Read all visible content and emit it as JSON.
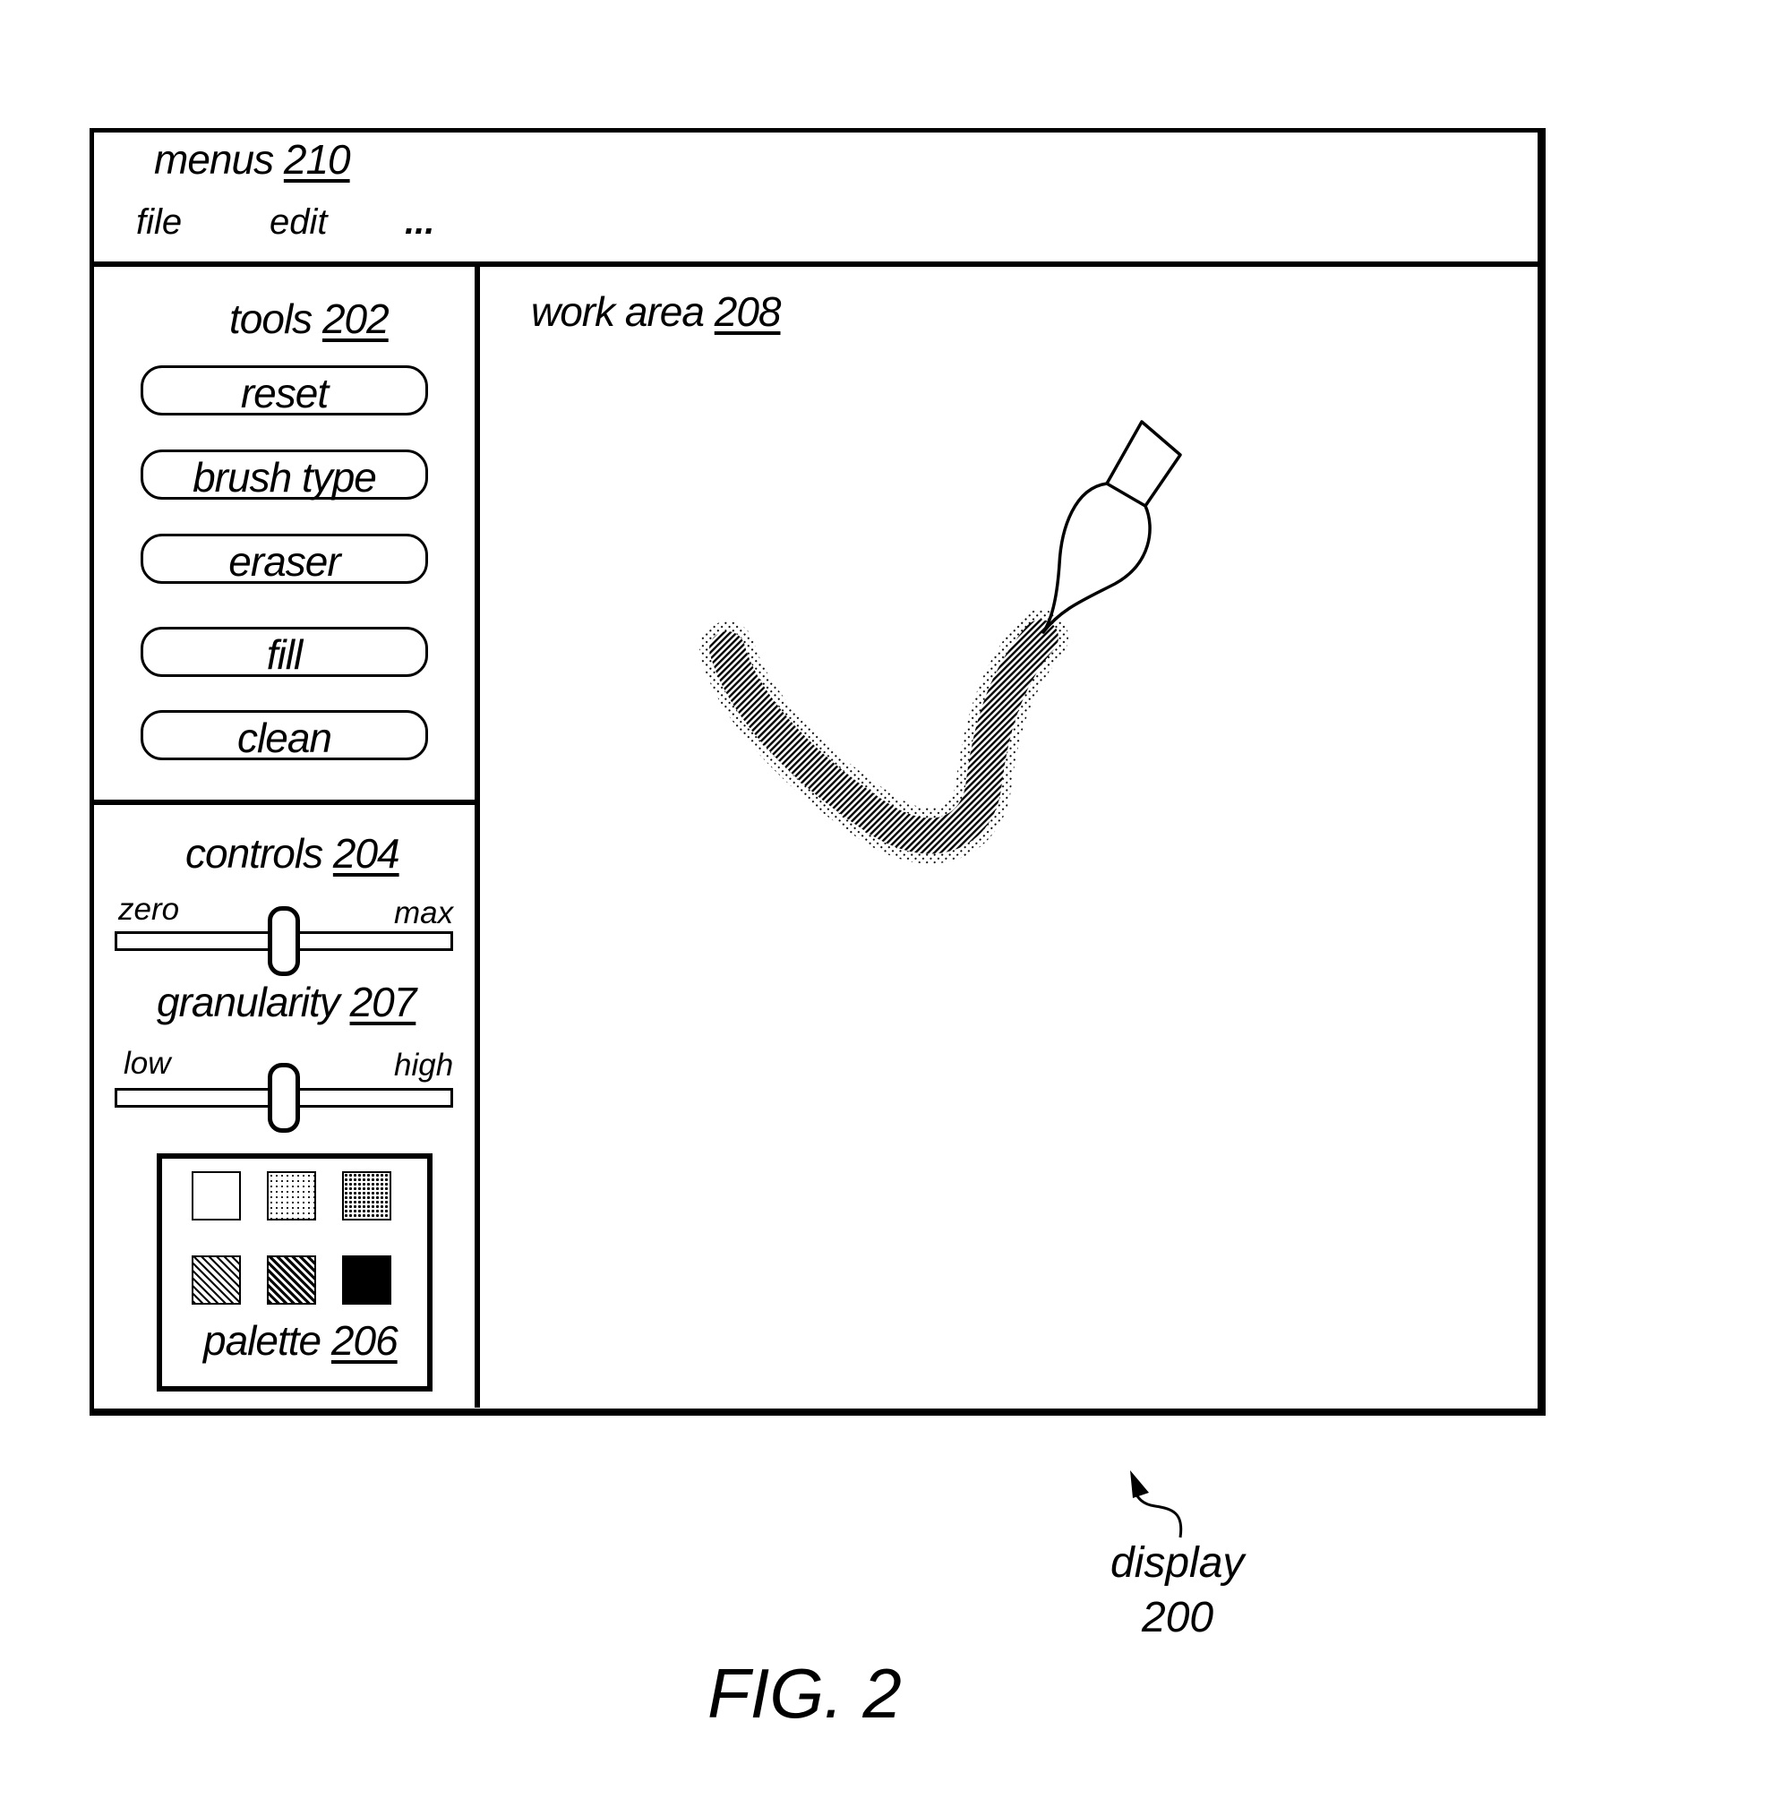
{
  "figure": {
    "caption": "FIG. 2",
    "display_label": "display",
    "display_ref": "200"
  },
  "menus": {
    "title": "menus",
    "ref": "210",
    "items": [
      {
        "label": "file"
      },
      {
        "label": "edit"
      },
      {
        "label": "..."
      }
    ]
  },
  "tools": {
    "title": "tools",
    "ref": "202",
    "buttons": [
      {
        "label": "reset"
      },
      {
        "label": "brush type"
      },
      {
        "label": "eraser"
      },
      {
        "label": "fill"
      },
      {
        "label": "clean"
      }
    ]
  },
  "controls": {
    "title": "controls",
    "ref": "204",
    "slider1": {
      "min_label": "zero",
      "max_label": "max",
      "value_fraction": 0.5
    },
    "granularity": {
      "title": "granularity",
      "ref": "207",
      "min_label": "low",
      "max_label": "high",
      "value_fraction": 0.5
    }
  },
  "palette": {
    "title": "palette",
    "ref": "206",
    "swatches": [
      {
        "name": "white",
        "pattern": "solid-white"
      },
      {
        "name": "light-dots",
        "pattern": "light-dot-screen"
      },
      {
        "name": "dark-dots",
        "pattern": "dark-dot-screen"
      },
      {
        "name": "light-diagonal",
        "pattern": "light-diagonal-hatch"
      },
      {
        "name": "dark-diagonal",
        "pattern": "dark-diagonal-hatch"
      },
      {
        "name": "black",
        "pattern": "solid-black"
      }
    ]
  },
  "work_area": {
    "title": "work area",
    "ref": "208",
    "icons": {
      "brush": "paintbrush-icon",
      "stroke": "brush-stroke"
    }
  },
  "colors": {
    "ink": "#000000",
    "paper": "#ffffff"
  }
}
